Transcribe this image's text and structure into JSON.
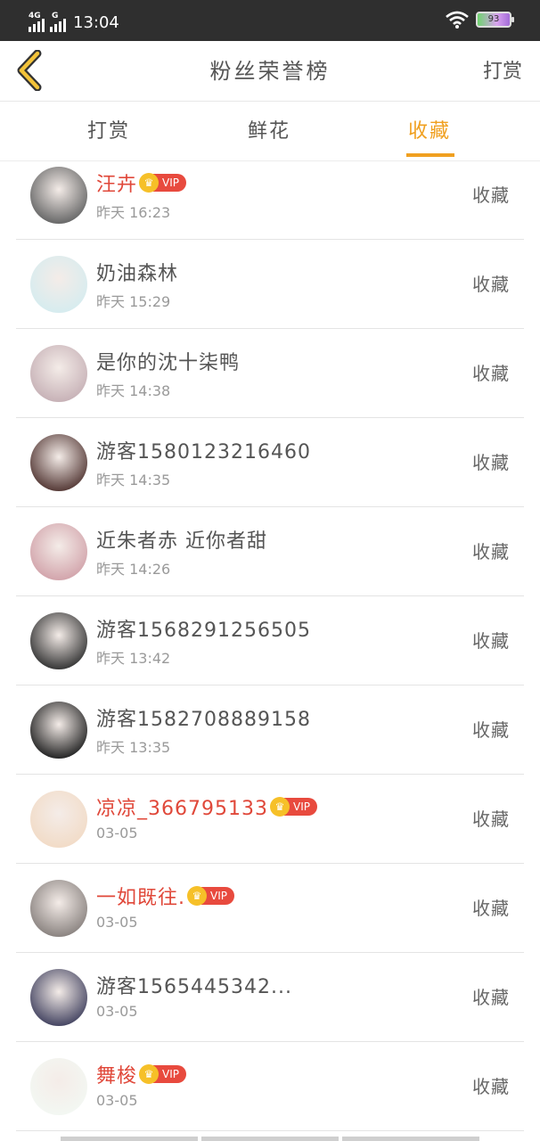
{
  "status_bar": {
    "network_left": "4G",
    "network_right": "G",
    "time": "13:04",
    "battery": "93"
  },
  "header": {
    "title": "粉丝荣誉榜",
    "action": "打赏"
  },
  "tabs": [
    {
      "label": "打赏",
      "active": false
    },
    {
      "label": "鲜花",
      "active": false
    },
    {
      "label": "收藏",
      "active": true
    }
  ],
  "accent_color": "#f0a020",
  "vip_color": "#e0483a",
  "vip_label": "VIP",
  "rows": [
    {
      "name": "汪卉",
      "vip": true,
      "time": "昨天 16:23",
      "action": "收藏",
      "avatar_color": "#6b6b6b"
    },
    {
      "name": "奶油森林",
      "vip": false,
      "time": "昨天 15:29",
      "action": "收藏",
      "avatar_color": "#d7ecef"
    },
    {
      "name": "是你的沈十柒鸭",
      "vip": false,
      "time": "昨天 14:38",
      "action": "收藏",
      "avatar_color": "#c8b3b8"
    },
    {
      "name": "游客1580123216460",
      "vip": false,
      "time": "昨天 14:35",
      "action": "收藏",
      "avatar_color": "#5a3f3c"
    },
    {
      "name": "近朱者赤 近你者甜",
      "vip": false,
      "time": "昨天 14:26",
      "action": "收藏",
      "avatar_color": "#d3a6ad"
    },
    {
      "name": "游客1568291256505",
      "vip": false,
      "time": "昨天 13:42",
      "action": "收藏",
      "avatar_color": "#3b3b3b"
    },
    {
      "name": "游客1582708889158",
      "vip": false,
      "time": "昨天 13:35",
      "action": "收藏",
      "avatar_color": "#2a2a2a"
    },
    {
      "name": "凉凉_366795133",
      "vip": true,
      "time": "03-05",
      "action": "收藏",
      "avatar_color": "#f2dcc8"
    },
    {
      "name": "一如既往.",
      "vip": true,
      "time": "03-05",
      "action": "收藏",
      "avatar_color": "#8d8683"
    },
    {
      "name": "游客1565445342...",
      "vip": false,
      "time": "03-05",
      "action": "收藏",
      "avatar_color": "#4a4a66"
    },
    {
      "name": "舞梭",
      "vip": true,
      "time": "03-05",
      "action": "收藏",
      "avatar_color": "#f3f7f2"
    }
  ]
}
